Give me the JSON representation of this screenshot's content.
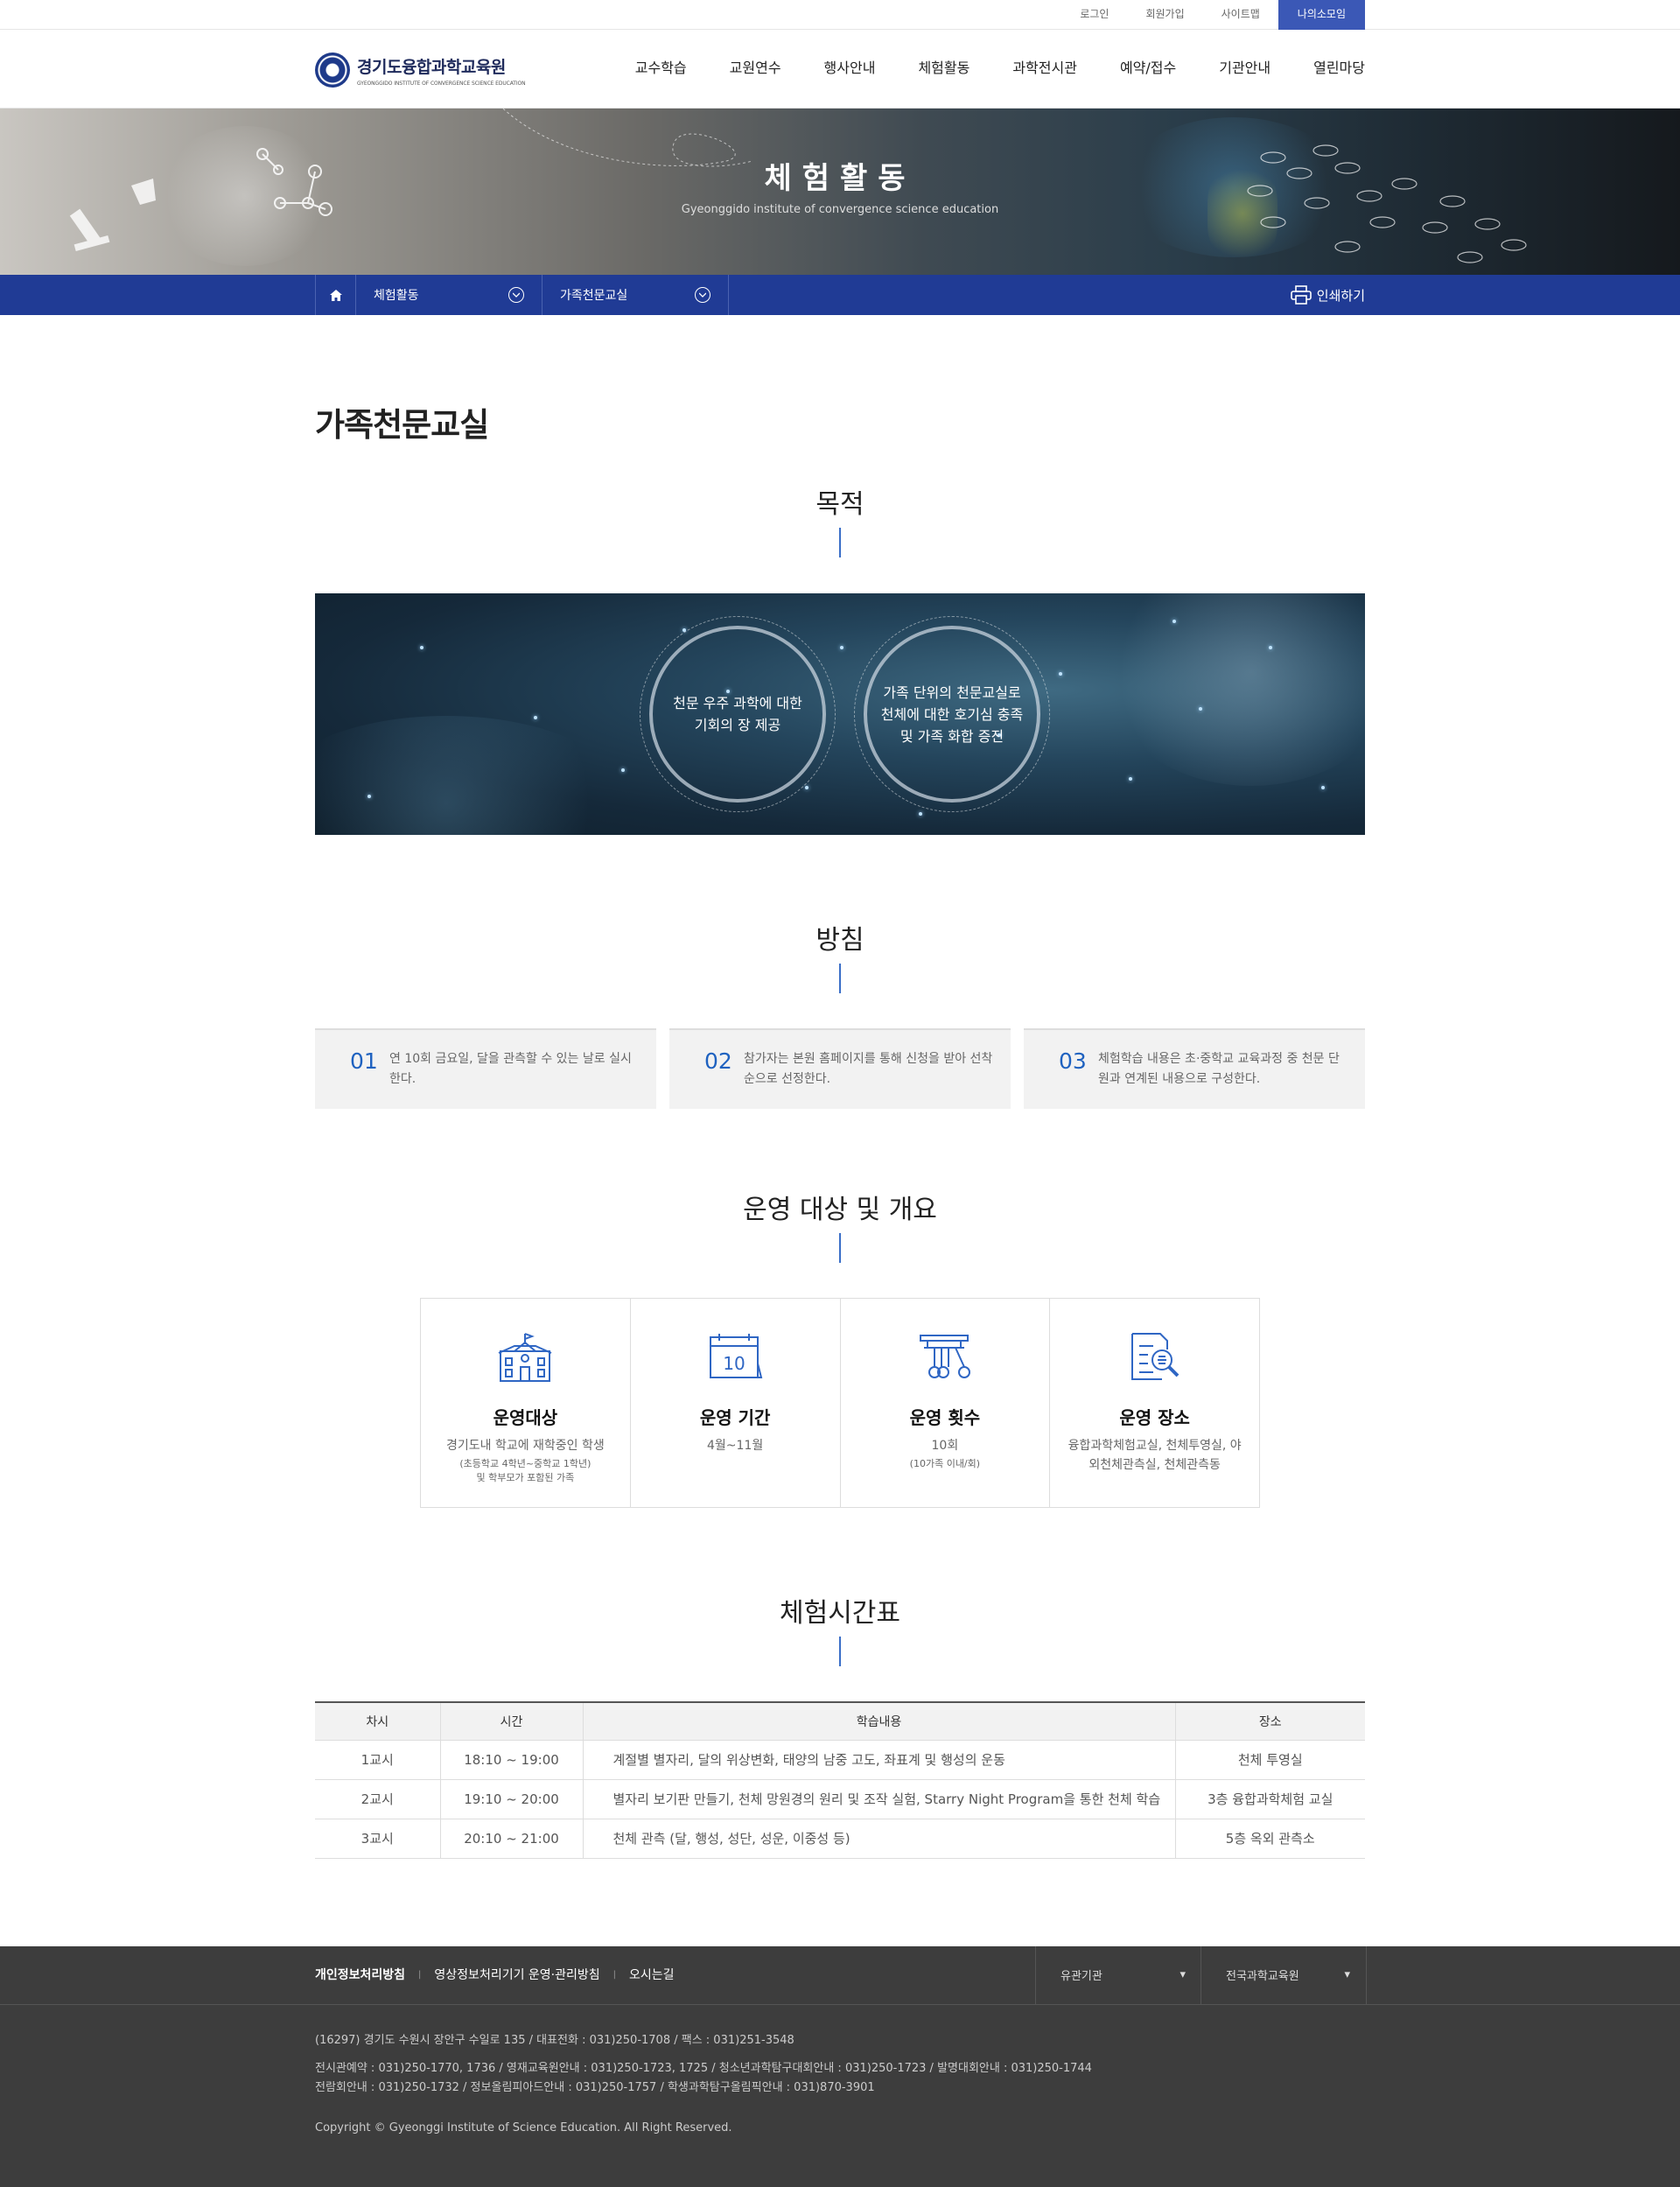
{
  "util": {
    "items": [
      "로그인",
      "회원가입",
      "사이트맵",
      "나의소모임"
    ]
  },
  "logo": {
    "ko": "경기도융합과학교육원",
    "en": "GYEONGGIDO INSTITUTE OF CONVERGENCE SCIENCE EDUCATION"
  },
  "menu": [
    "교수학습",
    "교원연수",
    "행사안내",
    "체험활동",
    "과학전시관",
    "예약/접수",
    "기관안내",
    "열린마당"
  ],
  "visual": {
    "title": "체험활동",
    "subtitle": "Gyeonggido institute of convergence science education"
  },
  "location": {
    "home_icon": "home-icon",
    "depth1": "체험활동",
    "depth2": "가족천문교실",
    "print": "인쇄하기"
  },
  "page_title": "가족천문교실",
  "purpose": {
    "title": "목적",
    "items": [
      "천문 우주 과학에 대한 기회의 장 제공",
      "가족 단위의 천문교실로 천체에 대한 호기심 충족 및 가족 화합 증진"
    ]
  },
  "policy": {
    "title": "방침",
    "items": [
      {
        "num": "01",
        "text": "연 10회 금요일, 달을 관측할 수 있는 날로 실시한다."
      },
      {
        "num": "02",
        "text": "참가자는 본원 홈페이지를 통해 신청을 받아 선착순으로 선정한다."
      },
      {
        "num": "03",
        "text": "체험학습 내용은 초·중학교 교육과정 중 천문 단원과 연계된 내용으로 구성한다."
      }
    ]
  },
  "overview": {
    "title": "운영 대상 및 개요",
    "items": [
      {
        "icon": "school-icon",
        "title": "운영대상",
        "desc": "경기도내 학교에 재학중인 학생",
        "sub": "(초등학교 4학년~중학교 1학년) 및 학부모가 포함된 가족"
      },
      {
        "icon": "calendar-icon",
        "title": "운영 기간",
        "desc": "4월~11월",
        "sub": "",
        "calendar_day": "10"
      },
      {
        "icon": "pendulum-icon",
        "title": "운영 횟수",
        "desc": "10회",
        "sub": "(10가족 이내/회)"
      },
      {
        "icon": "document-search-icon",
        "title": "운영 장소",
        "desc": "융합과학체험교실, 천체투영실, 야외천체관측실, 천체관측동",
        "sub": ""
      }
    ]
  },
  "schedule": {
    "title": "체험시간표",
    "headers": [
      "차시",
      "시간",
      "학습내용",
      "장소"
    ],
    "rows": [
      [
        "1교시",
        "18:10 ~ 19:00",
        "계절별 별자리, 달의 위상변화, 태양의 남중 고도, 좌표계 및 행성의 운동",
        "천체 투영실"
      ],
      [
        "2교시",
        "19:10 ~ 20:00",
        "별자리 보기판 만들기, 천체 망원경의 원리 및 조작 실험, Starry Night Program을 통한 천체 학습",
        "3층 융합과학체험 교실"
      ],
      [
        "3교시",
        "20:10 ~ 21:00",
        "천체 관측 (달, 행성, 성단, 성운, 이중성 등)",
        "5층 옥외 관측소"
      ]
    ]
  },
  "footer": {
    "links": [
      "개인정보처리방침",
      "영상정보처리기기 운영·관리방침",
      "오시는길"
    ],
    "select1": "유관기관",
    "select2": "전국과학교육원",
    "address": "(16297) 경기도 수원시 장안구 수일로 135 / 대표전화 : 031)250-1708 / 팩스 : 031)251-3548",
    "contacts1": "전시관예약 : 031)250-1770, 1736 / 영재교육원안내 : 031)250-1723, 1725 / 청소년과학탐구대회안내 : 031)250-1723 / 발명대회안내 : 031)250-1744",
    "contacts2": "전람회안내 : 031)250-1732 / 정보올림피아드안내 : 031)250-1757 / 학생과학탐구올림픽안내 : 031)870-3901",
    "copyright": "Copyright © Gyeonggi Institute of Science Education. All Right Reserved."
  }
}
